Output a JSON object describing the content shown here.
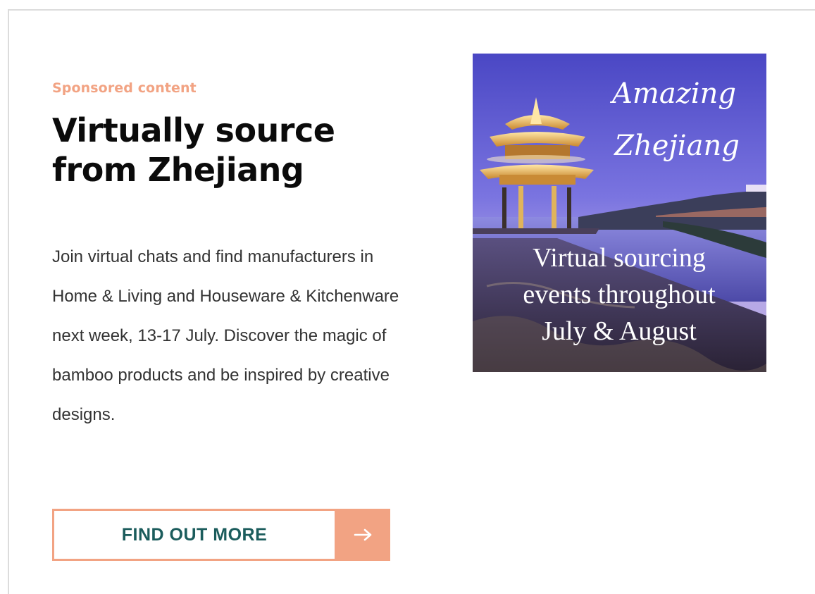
{
  "card": {
    "sponsored_label": "Sponsored content",
    "headline": "Virtually source from Zhejiang",
    "body": "Join virtual chats and find manufacturers in Home & Living and Houseware & Kitchenware next week, 13-17 July. Discover the magic of bamboo products and be inspired by creative designs.",
    "cta_label": "FIND OUT MORE",
    "cta_icon": "arrow-right-icon"
  },
  "promo_image": {
    "script_line_1": "Amazing",
    "script_line_2": "Zhejiang",
    "caption_line_1": "Virtual sourcing",
    "caption_line_2": "events throughout",
    "caption_line_3": "July & August"
  },
  "colors": {
    "accent": "#f2a383",
    "cta_text": "#1b5c5c",
    "headline": "#0b0b0b",
    "body": "#333333"
  }
}
